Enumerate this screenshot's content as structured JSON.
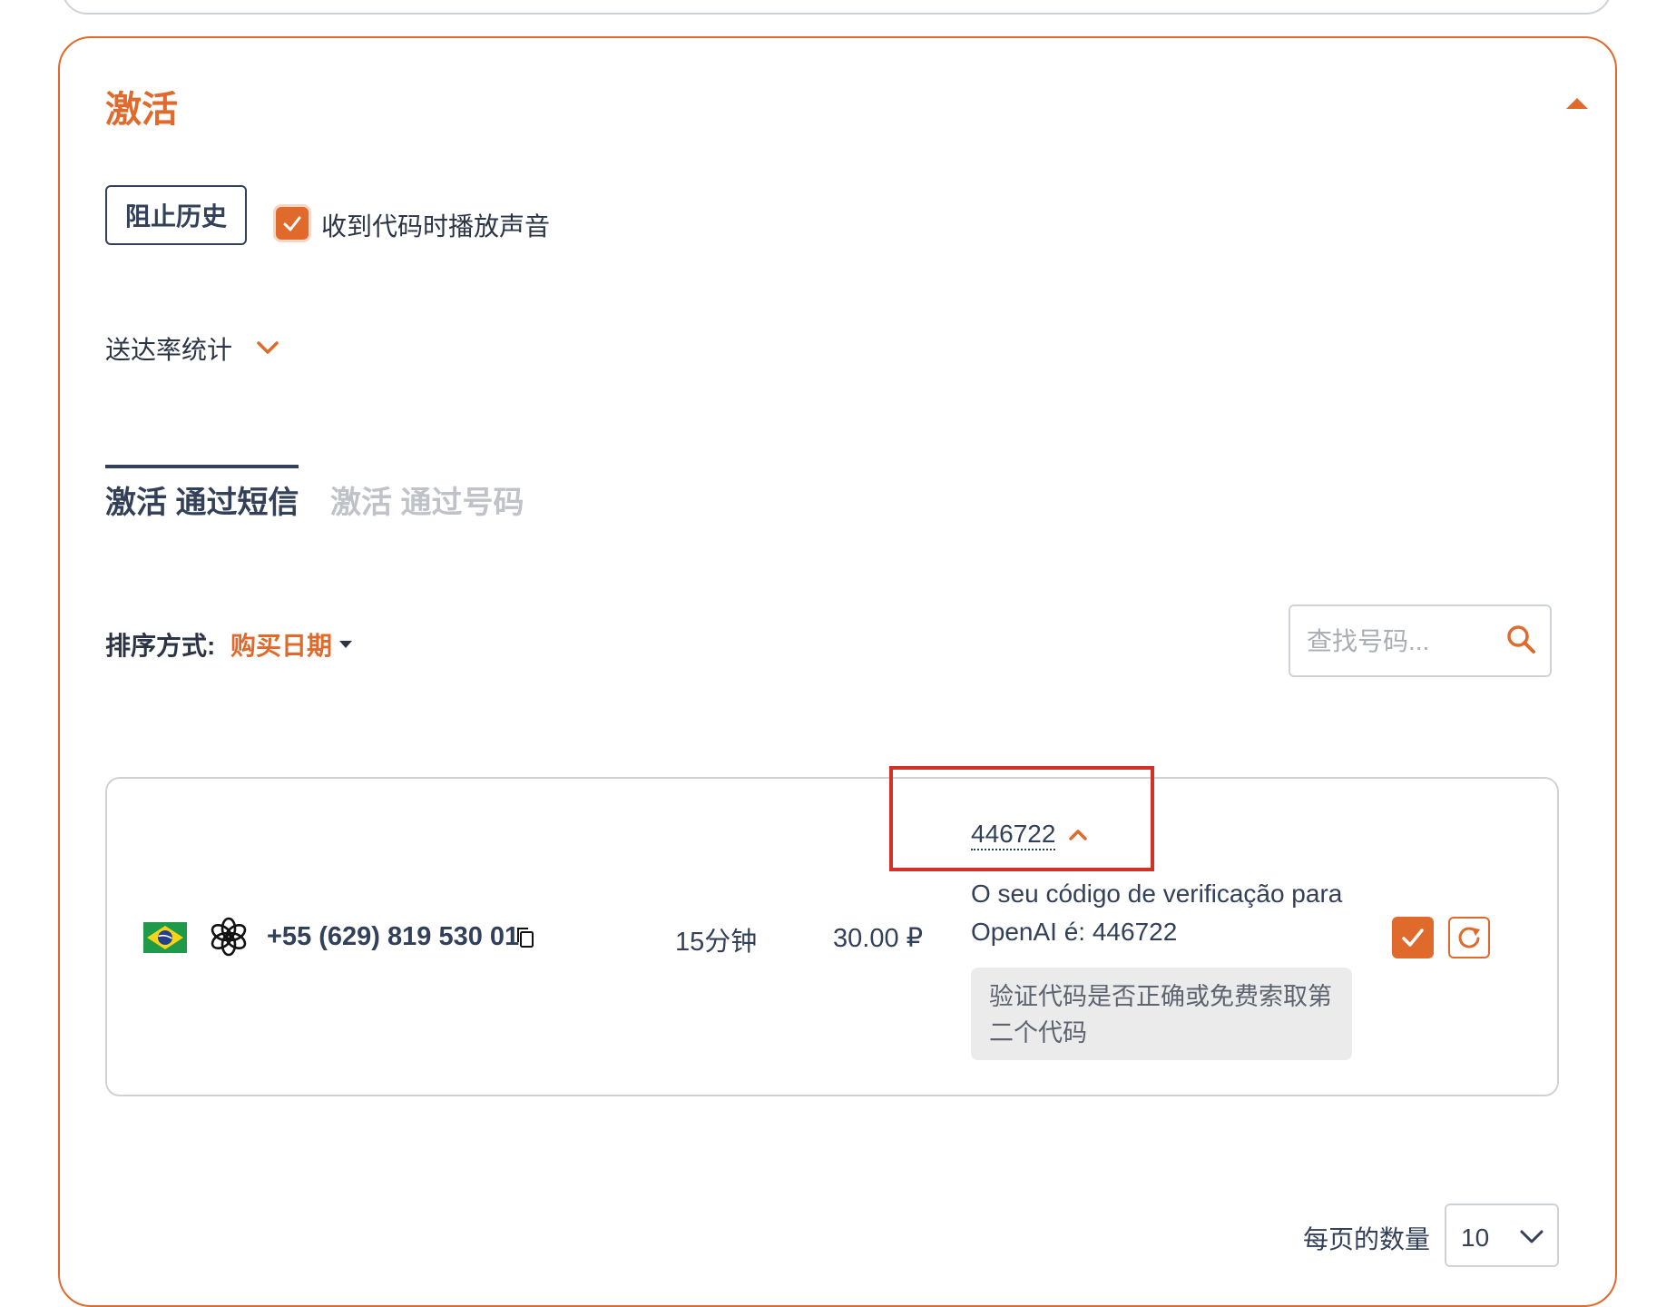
{
  "panel": {
    "title": "激活"
  },
  "controls": {
    "block_history_label": "阻止历史",
    "sound_label": "收到代码时播放声音",
    "sound_checked": true,
    "stats_label": "送达率统计"
  },
  "tabs": [
    {
      "label": "激活 通过短信",
      "active": true
    },
    {
      "label": "激活 通过号码",
      "active": false
    }
  ],
  "sort": {
    "label": "排序方式:",
    "value": "购买日期"
  },
  "search": {
    "placeholder": "查找号码..."
  },
  "activation": {
    "country_flag": "brazil-flag",
    "service_icon": "openai-icon",
    "phone": "+55 (629) 819 530 01",
    "duration": "15分钟",
    "price": "30.00 ₽",
    "code": "446722",
    "message": "O seu código de verificação para OpenAI é: 446722",
    "verify_hint": "验证代码是否正确或免费索取第二个代码"
  },
  "pagination": {
    "per_page_label": "每页的数量",
    "per_page_value": "10"
  },
  "colors": {
    "accent": "#e06a2c",
    "text_dark": "#33405a",
    "highlight": "#d33128",
    "border": "#cfd2d7"
  }
}
